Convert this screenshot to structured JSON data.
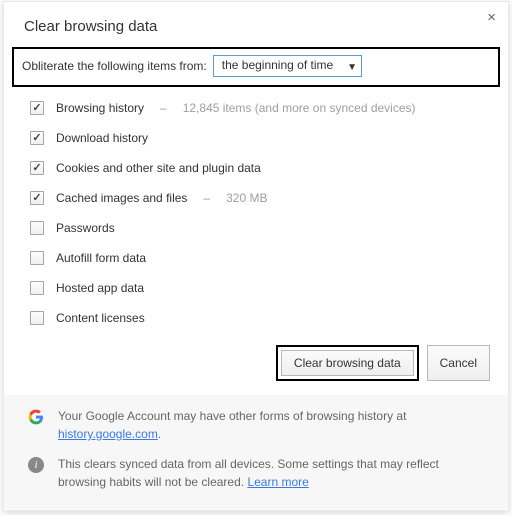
{
  "title": "Clear browsing data",
  "close_glyph": "×",
  "obliterate": {
    "label": "Obliterate the following items from:",
    "selected": "the beginning of time",
    "caret": "▼"
  },
  "items": [
    {
      "label": "Browsing history",
      "checked": true,
      "extra": "12,845 items (and more on synced devices)"
    },
    {
      "label": "Download history",
      "checked": true,
      "extra": ""
    },
    {
      "label": "Cookies and other site and plugin data",
      "checked": true,
      "extra": ""
    },
    {
      "label": "Cached images and files",
      "checked": true,
      "extra": "320 MB"
    },
    {
      "label": "Passwords",
      "checked": false,
      "extra": ""
    },
    {
      "label": "Autofill form data",
      "checked": false,
      "extra": ""
    },
    {
      "label": "Hosted app data",
      "checked": false,
      "extra": ""
    },
    {
      "label": "Content licenses",
      "checked": false,
      "extra": ""
    }
  ],
  "buttons": {
    "primary": "Clear browsing data",
    "cancel": "Cancel"
  },
  "info": {
    "row1_pre": "Your Google Account may have other forms of browsing history at ",
    "row1_link": "history.google.com",
    "row1_post": ".",
    "row2_pre": "This clears synced data from all devices. Some settings that may reflect browsing habits will not be cleared. ",
    "row2_link": "Learn more"
  }
}
